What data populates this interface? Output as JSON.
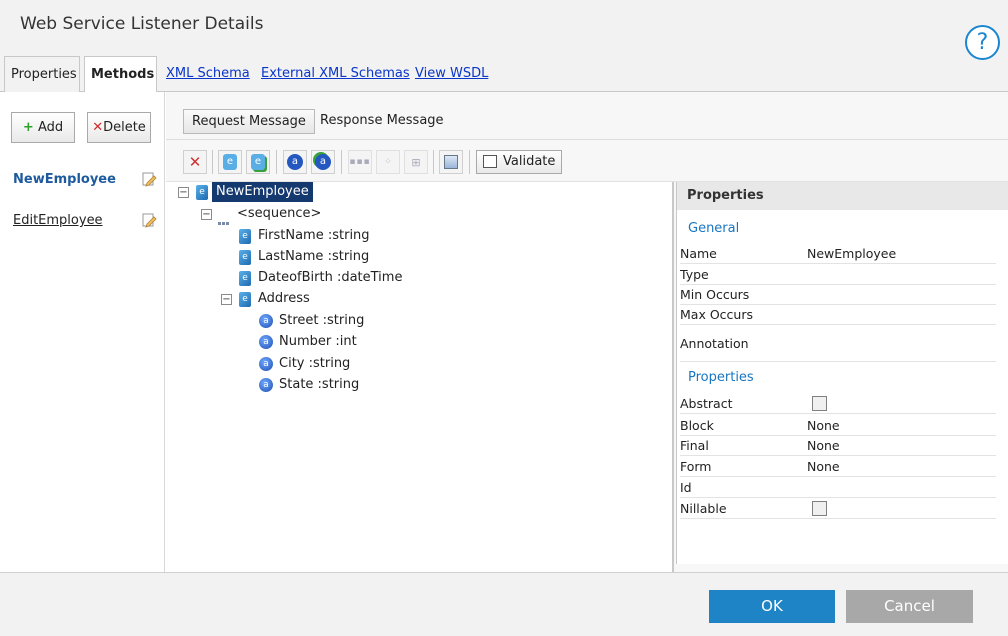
{
  "window": {
    "title": "Web Service Listener Details",
    "help_label": "?"
  },
  "tabs": [
    {
      "label": "Properties"
    },
    {
      "label": "Methods"
    },
    {
      "label": "XML Schema"
    },
    {
      "label": "External XML Schemas"
    },
    {
      "label": "View WSDL"
    }
  ],
  "left": {
    "add_label": "Add",
    "delete_label": "Delete",
    "methods": [
      {
        "label": "NewEmployee"
      },
      {
        "label": "EditEmployee"
      }
    ]
  },
  "message_tabs": [
    {
      "label": "Request Message"
    },
    {
      "label": "Response Message"
    }
  ],
  "toolbar": {
    "validate_label": "Validate"
  },
  "tree": [
    {
      "label": "NewEmployee"
    },
    {
      "label": "<sequence>"
    },
    {
      "label": "FirstName :string"
    },
    {
      "label": "LastName :string"
    },
    {
      "label": "DateofBirth :dateTime"
    },
    {
      "label": "Address"
    },
    {
      "label": "Street :string"
    },
    {
      "label": "Number :int"
    },
    {
      "label": "City :string"
    },
    {
      "label": "State :string"
    }
  ],
  "properties": {
    "header": "Properties",
    "general_label": "General",
    "general": [
      {
        "key": "Name",
        "value": "NewEmployee"
      },
      {
        "key": "Type",
        "value": ""
      },
      {
        "key": "Min Occurs",
        "value": ""
      },
      {
        "key": "Max Occurs",
        "value": ""
      },
      {
        "key": "Annotation",
        "value": ""
      }
    ],
    "props_label": "Properties",
    "props": [
      {
        "key": "Abstract",
        "checked": false
      },
      {
        "key": "Block",
        "value": "None"
      },
      {
        "key": "Final",
        "value": "None"
      },
      {
        "key": "Form",
        "value": "None"
      },
      {
        "key": "Id",
        "value": ""
      },
      {
        "key": "Nillable",
        "checked": false
      }
    ]
  },
  "footer": {
    "ok_label": "OK",
    "cancel_label": "Cancel"
  }
}
